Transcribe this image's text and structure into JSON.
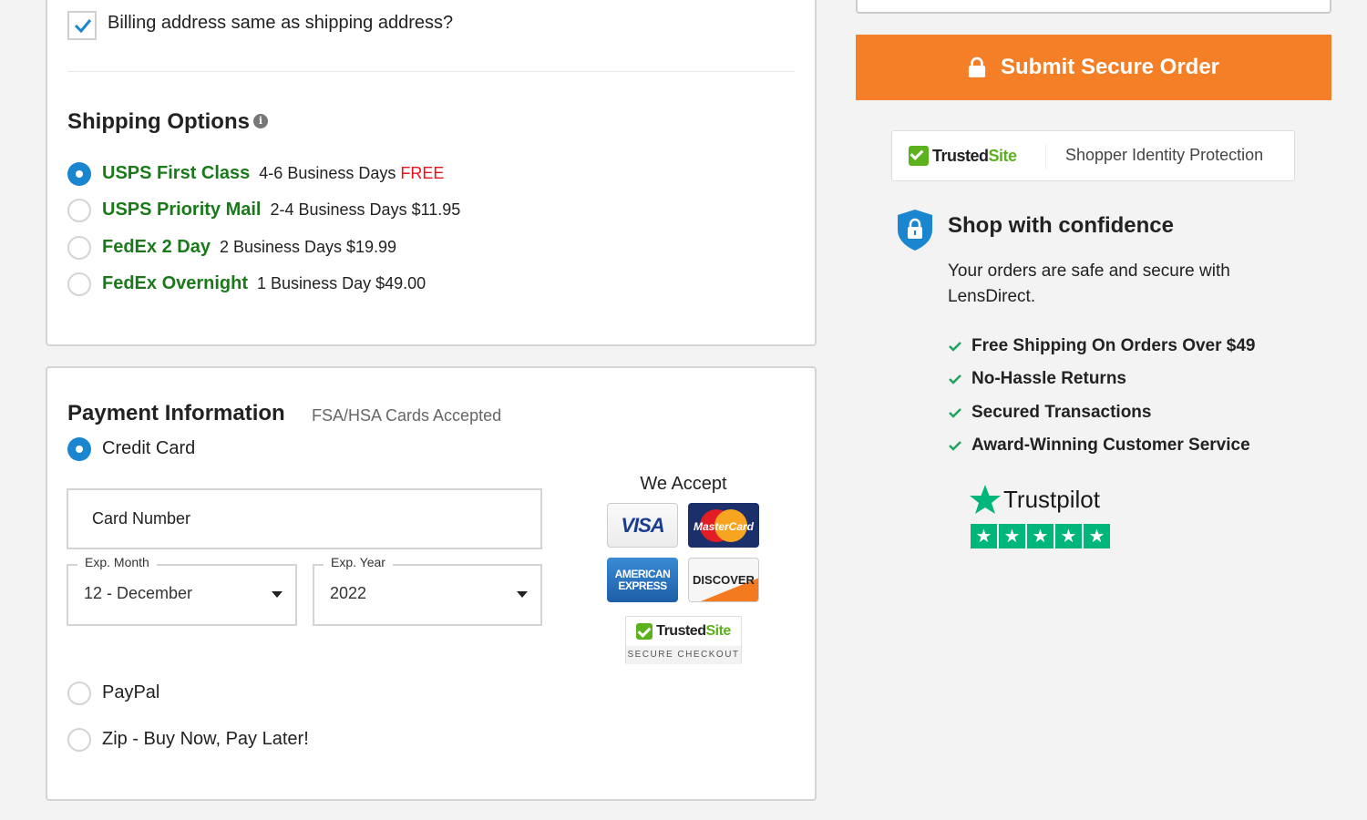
{
  "billing": {
    "same_as_shipping_label": "Billing address same as shipping address?",
    "same_as_shipping_checked": true
  },
  "shipping": {
    "title": "Shipping Options",
    "info_icon": "info-icon",
    "options": [
      {
        "name": "USPS First Class",
        "detail": "4-6 Business Days",
        "price": "FREE",
        "selected": true
      },
      {
        "name": "USPS Priority Mail",
        "detail": "2-4 Business Days",
        "price": "$11.95",
        "selected": false
      },
      {
        "name": "FedEx 2 Day",
        "detail": "2 Business Days",
        "price": "$19.99",
        "selected": false
      },
      {
        "name": "FedEx Overnight",
        "detail": "1 Business Day",
        "price": "$49.00",
        "selected": false
      }
    ]
  },
  "payment": {
    "title": "Payment Information",
    "subtitle": "FSA/HSA Cards Accepted",
    "methods": [
      {
        "label": "Credit Card",
        "selected": true
      },
      {
        "label": "PayPal",
        "selected": false
      },
      {
        "label": "Zip - Buy Now, Pay Later!",
        "selected": false
      }
    ],
    "card_number": {
      "placeholder": "Card Number",
      "value": ""
    },
    "exp_month": {
      "label": "Exp. Month",
      "value": "12 - December"
    },
    "exp_year": {
      "label": "Exp. Year",
      "value": "2022"
    },
    "we_accept": {
      "title": "We Accept",
      "cards": [
        "VISA",
        "MasterCard",
        "American Express",
        "DISCOVER"
      ],
      "visa_text": "VISA",
      "mc_text": "MasterCard",
      "amex_line1": "AMERICAN",
      "amex_line2": "EXPRESS",
      "discover_text": "DISCOVER"
    },
    "trusted_checkout": {
      "brand_a": "Trusted",
      "brand_b": "Site",
      "reg": "®",
      "caption": "SECURE CHECKOUT"
    }
  },
  "sidebar": {
    "submit_label": "Submit Secure Order",
    "trusted_badge": {
      "brand_a": "Trusted",
      "brand_b": "Site",
      "reg": "®",
      "text": "Shopper Identity Protection"
    },
    "confidence": {
      "title": "Shop with confidence",
      "text": "Your orders are safe and secure with LensDirect."
    },
    "benefits": [
      "Free Shipping On Orders Over $49",
      "No-Hassle Returns",
      "Secured Transactions",
      "Award-Winning Customer Service"
    ],
    "trustpilot": {
      "name": "Trustpilot",
      "stars": 5,
      "star_glyph": "★"
    }
  },
  "colors": {
    "accent_orange": "#f47f26",
    "radio_blue": "#1a86d0",
    "shipping_green": "#1a7a1a",
    "free_red": "#e8141c",
    "trustpilot_green": "#00b67a",
    "trustedsite_green": "#5cb21d"
  }
}
